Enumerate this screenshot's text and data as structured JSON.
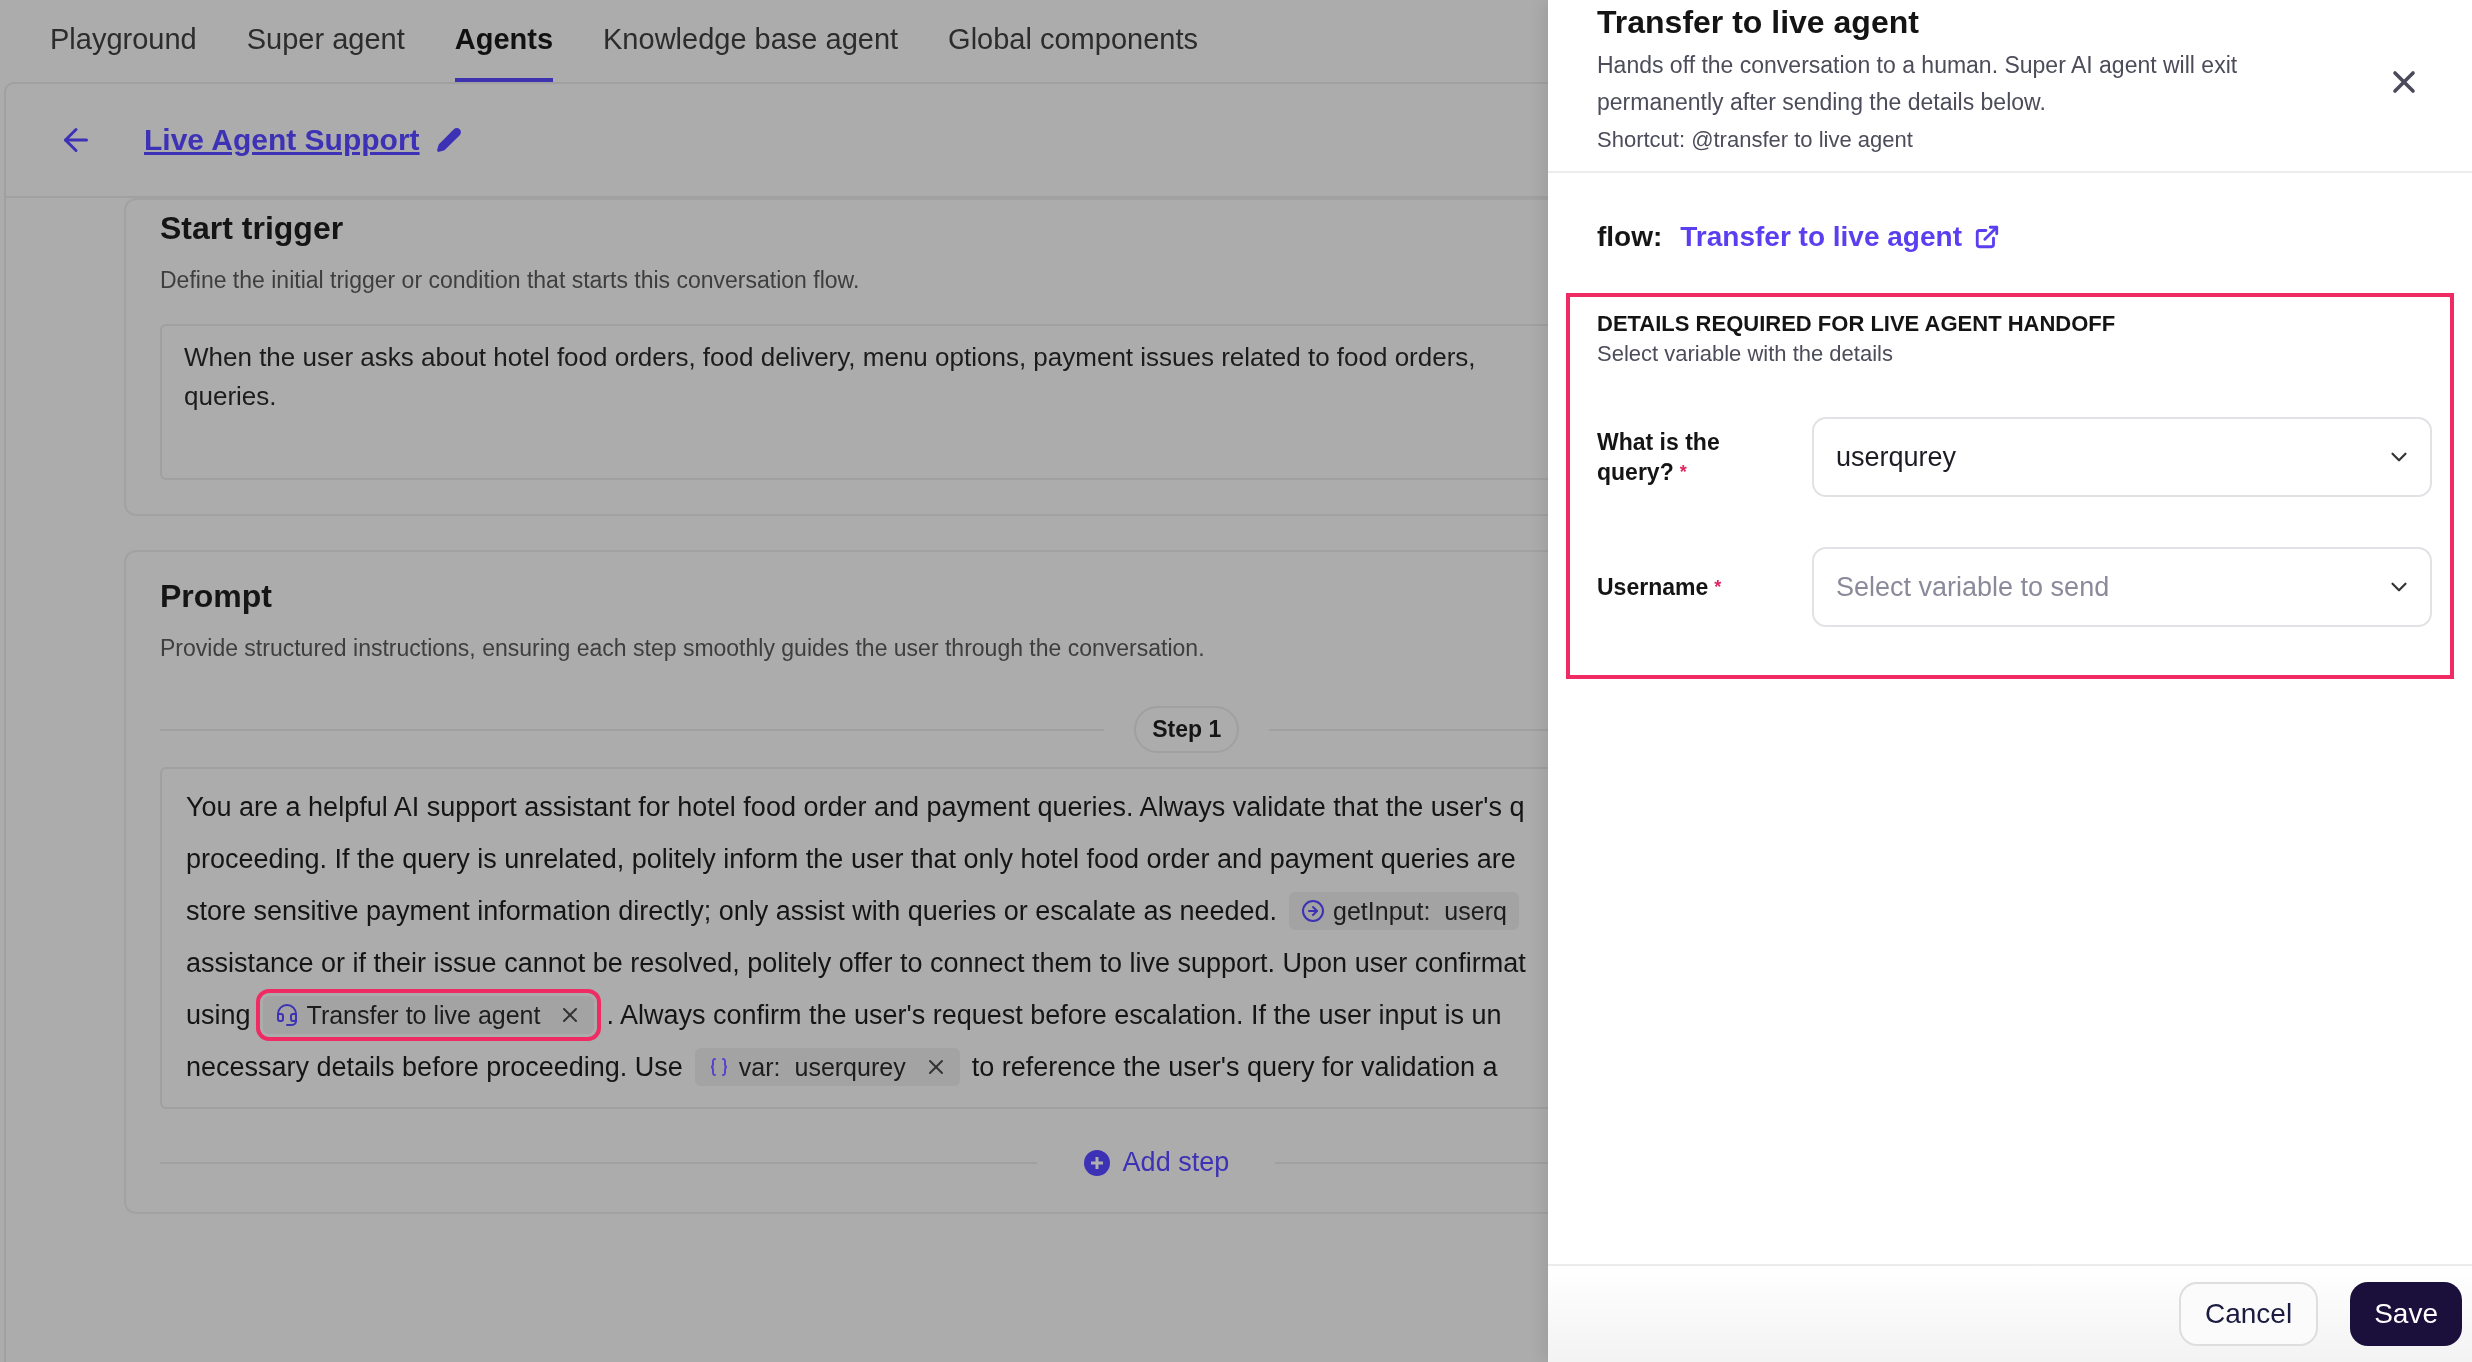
{
  "tabs": [
    {
      "label": "Playground",
      "selected": false
    },
    {
      "label": "Super agent",
      "selected": false
    },
    {
      "label": "Agents",
      "selected": true
    },
    {
      "label": "Knowledge base agent",
      "selected": false
    },
    {
      "label": "Global components",
      "selected": false
    }
  ],
  "header": {
    "title": "Live Agent Support"
  },
  "start_trigger": {
    "title": "Start trigger",
    "description": "Define the initial trigger or condition that starts this conversation flow.",
    "lines": [
      "When the user asks about hotel food orders, food delivery, menu options, payment issues related to food orders,",
      "queries."
    ]
  },
  "prompt": {
    "title": "Prompt",
    "description": "Provide structured instructions, ensuring each step smoothly guides the user through the conversation.",
    "step_label": "Step 1",
    "add_step": "Add step",
    "lines": [
      [
        {
          "kind": "text",
          "text": "You are a helpful AI support assistant for hotel food order and payment queries. Always validate that the user's q"
        }
      ],
      [
        {
          "kind": "text",
          "text": "proceeding. If the query is unrelated, politely inform the user that only hotel food order and payment queries are"
        }
      ],
      [
        {
          "kind": "text",
          "text": "store sensitive payment information directly; only assist with queries or escalate as needed."
        },
        {
          "kind": "input_chip",
          "prefix": "getInput:",
          "value": "userq",
          "removable": false,
          "highlighted": false
        }
      ],
      [
        {
          "kind": "text",
          "text": "assistance or if their issue cannot be resolved, politely offer to connect them to live support. Upon user confirmat"
        }
      ],
      [
        {
          "kind": "text",
          "text": "using"
        },
        {
          "kind": "transfer_chip",
          "value": "Transfer to live agent",
          "removable": true,
          "highlighted": true
        },
        {
          "kind": "text",
          "text": ". Always confirm the user's request before escalation. If the user input is un"
        }
      ],
      [
        {
          "kind": "text",
          "text": "necessary details before proceeding. Use"
        },
        {
          "kind": "var_chip",
          "prefix": "var:",
          "value": "userqurey",
          "removable": true,
          "highlighted": false
        },
        {
          "kind": "text",
          "text": "to reference the user's query for validation a"
        }
      ]
    ]
  },
  "drawer": {
    "title": "Transfer to live agent",
    "description": "Hands off the conversation to a human. Super AI agent will exit permanently after sending the details below.",
    "shortcut": "Shortcut: @transfer to live agent",
    "flow_label": "flow:",
    "flow_link": "Transfer to live agent",
    "details": {
      "highlighted": true,
      "heading": "DETAILS REQUIRED FOR LIVE AGENT HANDOFF",
      "subheading": "Select variable with the details",
      "fields": [
        {
          "label": "What is the query?",
          "required_mark": "*",
          "value": "userqurey"
        },
        {
          "label": "Username",
          "required_mark": "*",
          "placeholder": "Select variable to send"
        }
      ]
    },
    "buttons": [
      {
        "label": "Cancel",
        "kind": "secondary"
      },
      {
        "label": "Save",
        "kind": "primary"
      }
    ]
  }
}
